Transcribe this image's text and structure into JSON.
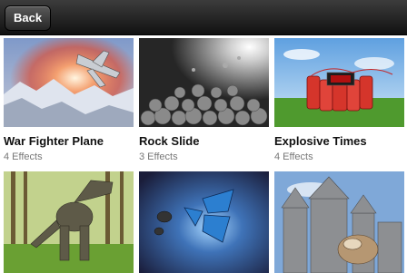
{
  "header": {
    "back_label": "Back"
  },
  "cards": [
    {
      "title": "War Fighter Plane",
      "subtitle": "4 Effects"
    },
    {
      "title": "Rock Slide",
      "subtitle": "3 Effects"
    },
    {
      "title": "Explosive Times",
      "subtitle": "4 Effects"
    },
    {
      "title": "",
      "subtitle": ""
    },
    {
      "title": "",
      "subtitle": ""
    },
    {
      "title": "",
      "subtitle": ""
    }
  ]
}
